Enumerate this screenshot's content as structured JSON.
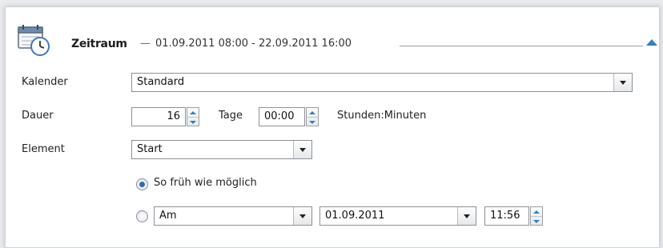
{
  "header": {
    "title": "Zeitraum",
    "range": "01.09.2011 08:00 - 22.09.2011 16:00"
  },
  "labels": {
    "calendar": "Kalender",
    "duration": "Dauer",
    "element": "Element"
  },
  "calendar": {
    "value": "Standard"
  },
  "duration": {
    "days_value": "16",
    "days_unit": "Tage",
    "time_value": "00:00",
    "time_unit": "Stunden:Minuten"
  },
  "element": {
    "value": "Start"
  },
  "options": {
    "asap_label": "So früh wie möglich",
    "asap_selected": true,
    "on_selected": false,
    "on_mode": "Am",
    "on_date": "01.09.2011",
    "on_time": "11:56"
  },
  "colors": {
    "accent": "#2f7fc2",
    "radio_dot": "#2a6fb5",
    "border": "#8c9298"
  },
  "icons": {
    "header": "calendar-clock-icon",
    "collapse": "collapse-up-icon"
  }
}
